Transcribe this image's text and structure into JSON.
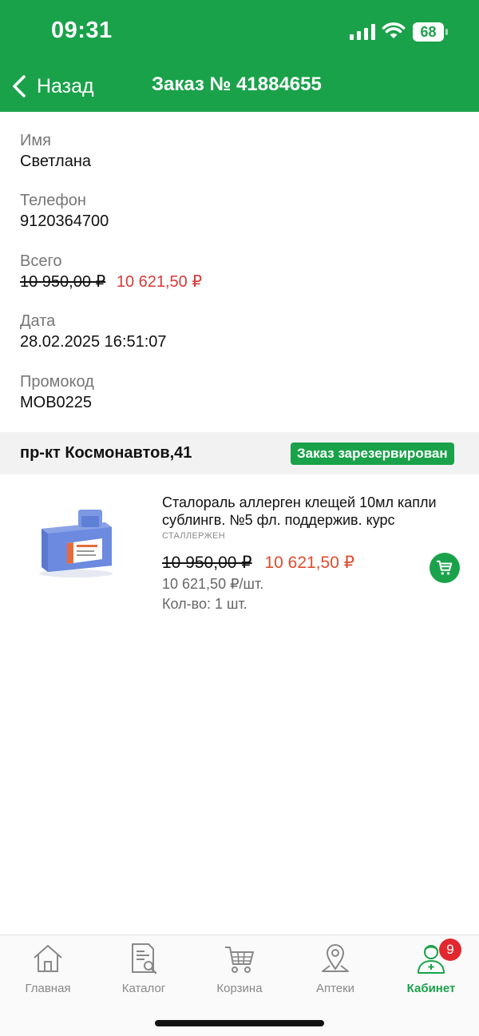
{
  "status_bar": {
    "time": "09:31",
    "battery": "68"
  },
  "header": {
    "back_label": "Назад",
    "title": "Заказ № 41884655"
  },
  "order": {
    "name_label": "Имя",
    "name_value": "Светлана",
    "phone_label": "Телефон",
    "phone_value": "9120364700",
    "total_label": "Всего",
    "total_old": "10 950,00 ₽",
    "total_new": "10 621,50 ₽",
    "date_label": "Дата",
    "date_value": "28.02.2025 16:51:07",
    "promo_label": "Промокод",
    "promo_value": "MOB0225"
  },
  "store": {
    "name": "пр-кт Космонавтов,41",
    "status": "Заказ зарезервирован"
  },
  "product": {
    "name": "Сталораль аллерген клещей 10мл капли сублингв. №5 фл.  поддержив. курс",
    "brand": "СТАЛЛЕРЖЕН",
    "price_old": "10 950,00 ₽",
    "price_new": "10 621,50 ₽",
    "unit_price": "10 621,50 ₽/шт.",
    "quantity": "Кол-во: 1 шт."
  },
  "tabbar": {
    "home": "Главная",
    "catalog": "Каталог",
    "cart": "Корзина",
    "pharmacies": "Аптеки",
    "cabinet": "Кабинет",
    "cabinet_badge": "9"
  },
  "colors": {
    "brand_green": "#1aa24a",
    "price_red": "#d93a3a",
    "badge_red": "#e0282e"
  }
}
